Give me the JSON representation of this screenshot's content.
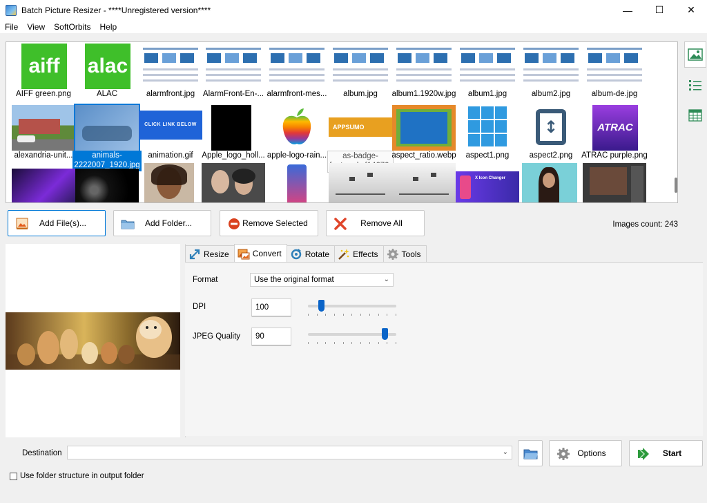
{
  "window": {
    "title": "Batch Picture Resizer - ****Unregistered version****",
    "controls": {
      "minimize": "—",
      "maximize": "☐",
      "close": "✕"
    }
  },
  "menu": [
    "File",
    "View",
    "SoftOrbits",
    "Help"
  ],
  "thumbnails": [
    {
      "caption": "AIFF green.png",
      "kind": "aiff",
      "text": "aiff"
    },
    {
      "caption": "ALAC",
      "kind": "alac",
      "text": "alac"
    },
    {
      "caption": "alarmfront.jpg",
      "kind": "doc"
    },
    {
      "caption": "AlarmFront-En-...",
      "kind": "doc"
    },
    {
      "caption": "alarmfront-mes...",
      "kind": "doc"
    },
    {
      "caption": "album.jpg",
      "kind": "doc"
    },
    {
      "caption": "album1.1920w.jpg",
      "kind": "doc"
    },
    {
      "caption": "album1.jpg",
      "kind": "doc"
    },
    {
      "caption": "album2.jpg",
      "kind": "doc"
    },
    {
      "caption": "album-de.jpg",
      "kind": "doc"
    },
    {
      "caption": "alexandria-unit...",
      "kind": "photo-house"
    },
    {
      "caption": "animals-2222007_1920.jpg",
      "kind": "photo-animals",
      "selected": true
    },
    {
      "caption": "animation.gif",
      "kind": "banner",
      "text": "CLICK LINK BELOW"
    },
    {
      "caption": "Apple_logo_holl...",
      "kind": "black"
    },
    {
      "caption": "apple-logo-rain...",
      "kind": "apple"
    },
    {
      "caption": "as-badge-featured.cf14670.",
      "kind": "appsumo",
      "text": "APPSUMO",
      "hover": true
    },
    {
      "caption": "aspect_ratio.webp",
      "kind": "aspect-ratio"
    },
    {
      "caption": "aspect1.png",
      "kind": "grid"
    },
    {
      "caption": "aspect2.png",
      "kind": "aspect2"
    },
    {
      "caption": "ATRAC purple.png",
      "kind": "atrac",
      "text": "ATRAC"
    },
    {
      "caption": "",
      "kind": "purple-screen"
    },
    {
      "caption": "",
      "kind": "dark-swirl"
    },
    {
      "caption": "",
      "kind": "portrait"
    },
    {
      "caption": "",
      "kind": "couple"
    },
    {
      "caption": "",
      "kind": "phone"
    },
    {
      "caption": "",
      "kind": "birds"
    },
    {
      "caption": "",
      "kind": "birds"
    },
    {
      "caption": "",
      "kind": "app-promo",
      "text": "X Icon Changer"
    },
    {
      "caption": "",
      "kind": "woman"
    },
    {
      "caption": "",
      "kind": "editor"
    },
    {
      "caption": "",
      "kind": "doc"
    }
  ],
  "buttons": {
    "add_files": "Add File(s)...",
    "add_folder": "Add Folder...",
    "remove_selected": "Remove Selected",
    "remove_all": "Remove All"
  },
  "images_count": "Images count: 243",
  "tabs": [
    "Resize",
    "Convert",
    "Rotate",
    "Effects",
    "Tools"
  ],
  "active_tab": "Convert",
  "convert": {
    "format_label": "Format",
    "format_value": "Use the original format",
    "dpi_label": "DPI",
    "dpi_value": "100",
    "dpi_slider_fraction": 0.13,
    "jpeg_label": "JPEG Quality",
    "jpeg_value": "90",
    "jpeg_slider_fraction": 0.9
  },
  "bottom": {
    "destination_label": "Destination",
    "destination_value": "",
    "options_label": "Options",
    "start_label": "Start",
    "folder_structure_label": "Use folder structure in output folder",
    "folder_structure_checked": false
  },
  "colors": {
    "accent": "#0078d7",
    "selection": "#0078d7",
    "slider": "#0a64c8"
  }
}
